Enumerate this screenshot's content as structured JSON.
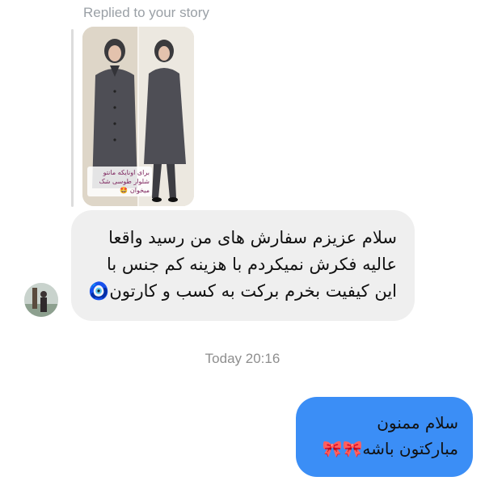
{
  "conversation": {
    "reply_context": {
      "label": "Replied to your story",
      "story_caption": "برای اونایکه مانتو شلوار طوسی شک میخوان 🤩"
    },
    "incoming_message": {
      "text": "سلام عزیزم سفارش های من رسید واقعا\nعالیه فکرش نمیکردم با هزینه کم جنس با\nاین کیفیت بخرم برکت به کسب و کارتون🧿"
    },
    "timestamp": "Today 20:16",
    "outgoing_message": {
      "text": "سلام ممنون\nمبارکتون باشه🎀🎀"
    },
    "colors": {
      "incoming_bubble": "#efefef",
      "outgoing_bubble": "#3b8ef6",
      "meta_text": "#9aa0a6"
    }
  }
}
